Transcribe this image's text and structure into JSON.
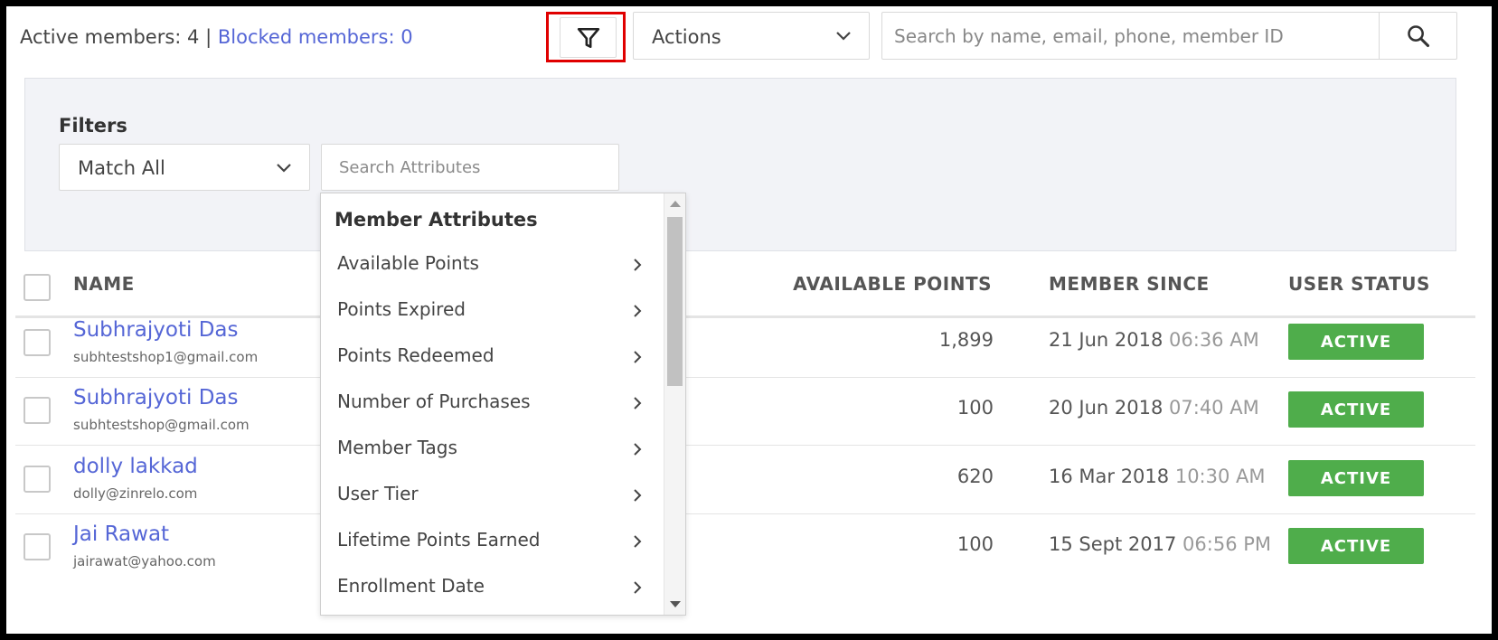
{
  "topbar": {
    "active_label": "Active members: 4",
    "separator": "|",
    "blocked_label": "Blocked members: 0",
    "actions_label": "Actions",
    "search_placeholder": "Search by name, email, phone, member ID"
  },
  "filters": {
    "title": "Filters",
    "match_label": "Match All",
    "attr_search_placeholder": "Search Attributes"
  },
  "dropdown": {
    "header": "Member Attributes",
    "items": [
      {
        "label": "Available Points"
      },
      {
        "label": "Points Expired"
      },
      {
        "label": "Points Redeemed"
      },
      {
        "label": "Number of Purchases"
      },
      {
        "label": "Member Tags"
      },
      {
        "label": "User Tier"
      },
      {
        "label": "Lifetime Points Earned"
      },
      {
        "label": "Enrollment Date"
      }
    ]
  },
  "table": {
    "columns": {
      "name": "NAME",
      "points": "AVAILABLE POINTS",
      "since": "MEMBER SINCE",
      "status": "USER STATUS"
    },
    "rows": [
      {
        "name": "Subhrajyoti Das",
        "email": "subhtestshop1@gmail.com",
        "points": "1,899",
        "date": "21 Jun 2018",
        "time": "06:36 AM",
        "status": "ACTIVE"
      },
      {
        "name": "Subhrajyoti Das",
        "email": "subhtestshop@gmail.com",
        "points": "100",
        "date": "20 Jun 2018",
        "time": "07:40 AM",
        "status": "ACTIVE"
      },
      {
        "name": "dolly lakkad",
        "email": "dolly@zinrelo.com",
        "points": "620",
        "date": "16 Mar 2018",
        "time": "10:30 AM",
        "status": "ACTIVE"
      },
      {
        "name": "Jai Rawat",
        "email": "jairawat@yahoo.com",
        "points": "100",
        "date": "15 Sept 2017",
        "time": "06:56 PM",
        "status": "ACTIVE"
      }
    ]
  },
  "colors": {
    "link": "#5566d6",
    "status_active": "#4fad4b",
    "highlight": "#e00000",
    "panel_bg": "#f2f3f7"
  },
  "icons": {
    "filter": "filter-icon",
    "search": "search-icon",
    "chevron": "chevron-down-icon",
    "arrow": "chevron-right-icon"
  }
}
